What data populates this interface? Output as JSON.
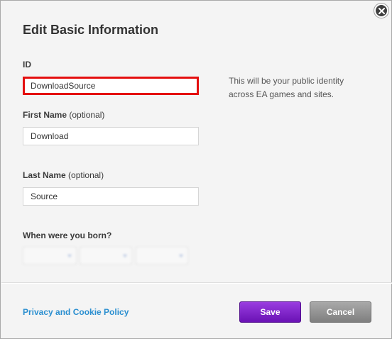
{
  "dialog": {
    "title": "Edit Basic Information",
    "close_icon": "close-icon"
  },
  "form": {
    "id": {
      "label": "ID",
      "value": "DownloadSource",
      "hint": "This will be your public identity across EA games and sites."
    },
    "first_name": {
      "label": "First Name",
      "optional": "(optional)",
      "value": "Download"
    },
    "last_name": {
      "label": "Last Name",
      "optional": "(optional)",
      "value": "Source"
    },
    "birthday": {
      "label": "When were you born?"
    }
  },
  "footer": {
    "privacy_link": "Privacy and Cookie Policy",
    "save_label": "Save",
    "cancel_label": "Cancel"
  },
  "colors": {
    "highlight_border": "#e40f0f",
    "save_button": "#7a1dc6",
    "cancel_button": "#8f8f8f",
    "link": "#2b8fd0"
  }
}
